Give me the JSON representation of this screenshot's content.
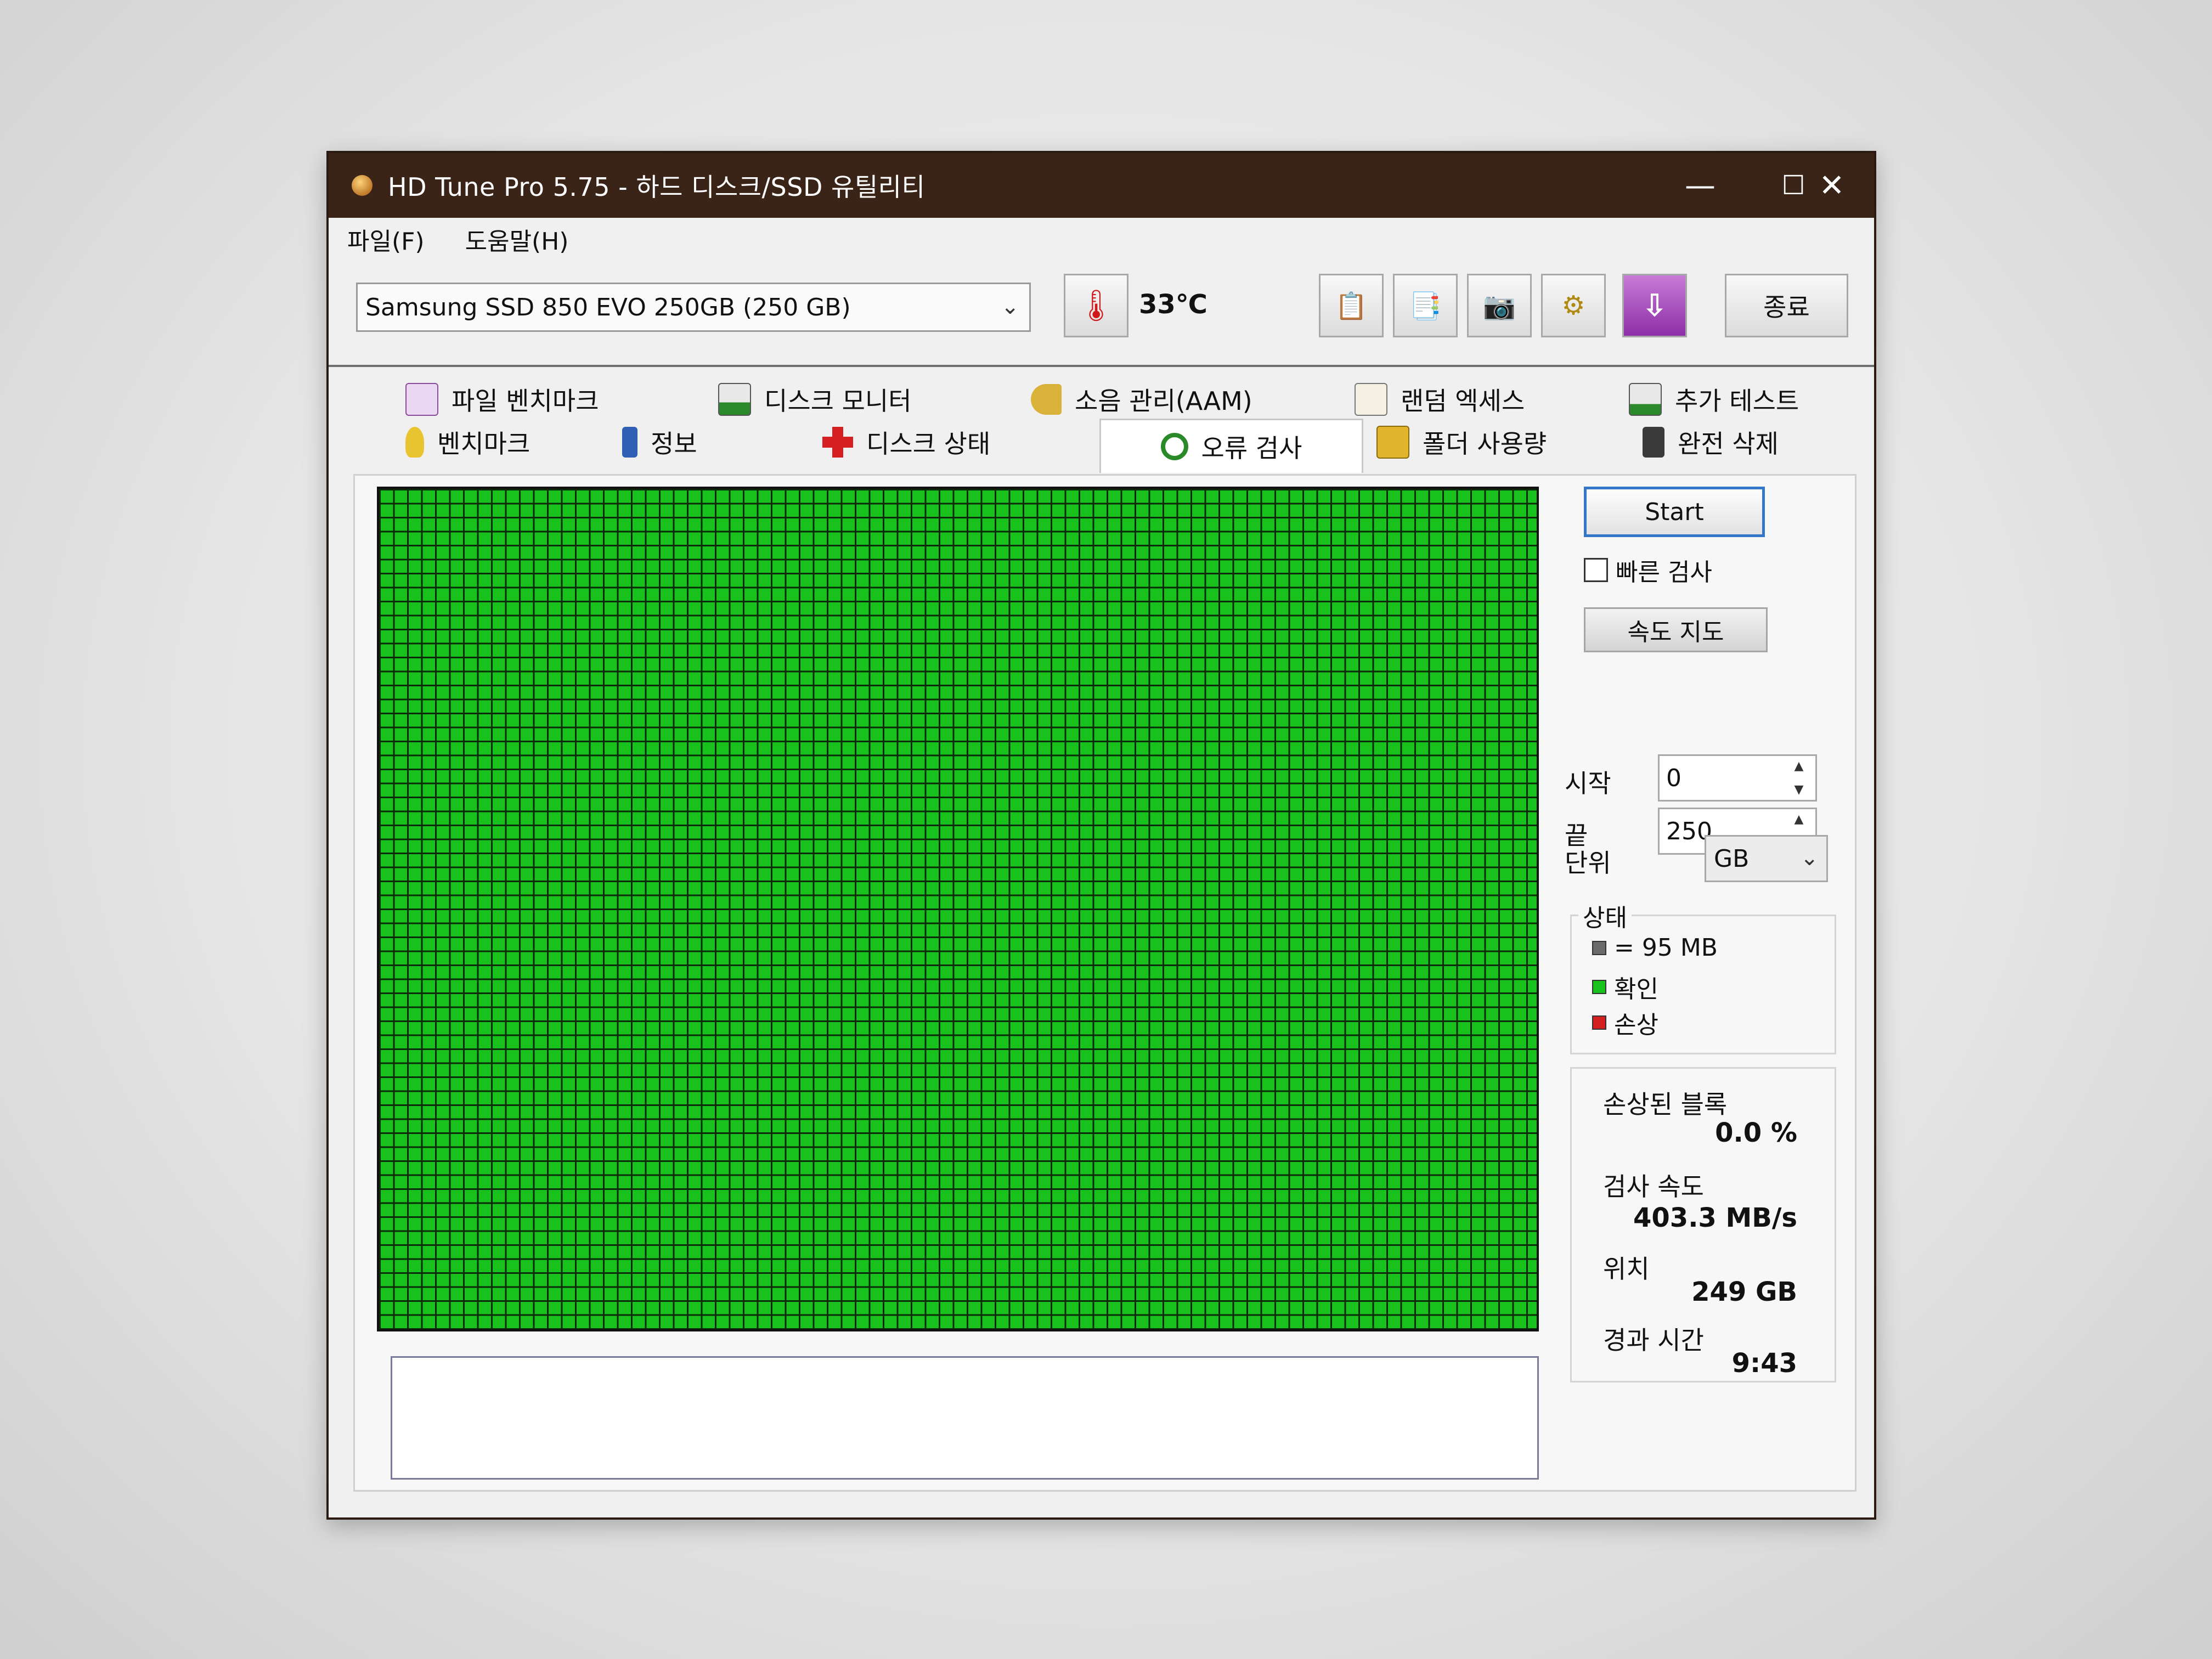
{
  "window": {
    "title": "HD Tune Pro 5.75 - 하드 디스크/SSD 유틸리티",
    "minimize": "—",
    "maximize": "☐",
    "close": "✕"
  },
  "menu": [
    "파일(F)",
    "도움말(H)"
  ],
  "toolbar": {
    "drive": "Samsung SSD 850 EVO 250GB (250 GB)",
    "temperature": "33℃",
    "exit_label": "종료"
  },
  "tabs": {
    "row1": [
      "파일 벤치마크",
      "디스크 모니터",
      "소음 관리(AAM)",
      "랜덤 엑세스",
      "추가 테스트"
    ],
    "row2": [
      "벤치마크",
      "정보",
      "디스크 상태",
      "오류 검사",
      "폴더 사용량",
      "완전 삭제"
    ],
    "active": "오류 검사"
  },
  "error_scan": {
    "start_label": "Start",
    "quick_scan_label": "빠른 검사",
    "quick_scan_checked": false,
    "speed_map_label": "속도 지도",
    "start_field_label": "시작",
    "start_value": "0",
    "end_field_label": "끝",
    "end_value": "250",
    "unit_label": "단위",
    "unit_value": "GB",
    "status_title": "상태",
    "legend": [
      {
        "label": "= 95 MB",
        "color": "#6b6b6b"
      },
      {
        "label": "확인",
        "color": "#19c11c"
      },
      {
        "label": "손상",
        "color": "#d21f1f"
      }
    ],
    "damaged_blocks_label": "손상된 블록",
    "damaged_blocks_value": "0.0 %",
    "scan_speed_label": "검사 속도",
    "scan_speed_value": "403.3 MB/s",
    "position_label": "위치",
    "position_value": "249 GB",
    "elapsed_label": "경과 시간",
    "elapsed_value": "9:43"
  },
  "colors": {
    "titlebar": "#3a2418",
    "block_ok": "#19c11c",
    "grid_line": "#0b2a08",
    "start_border": "#3277c9"
  }
}
